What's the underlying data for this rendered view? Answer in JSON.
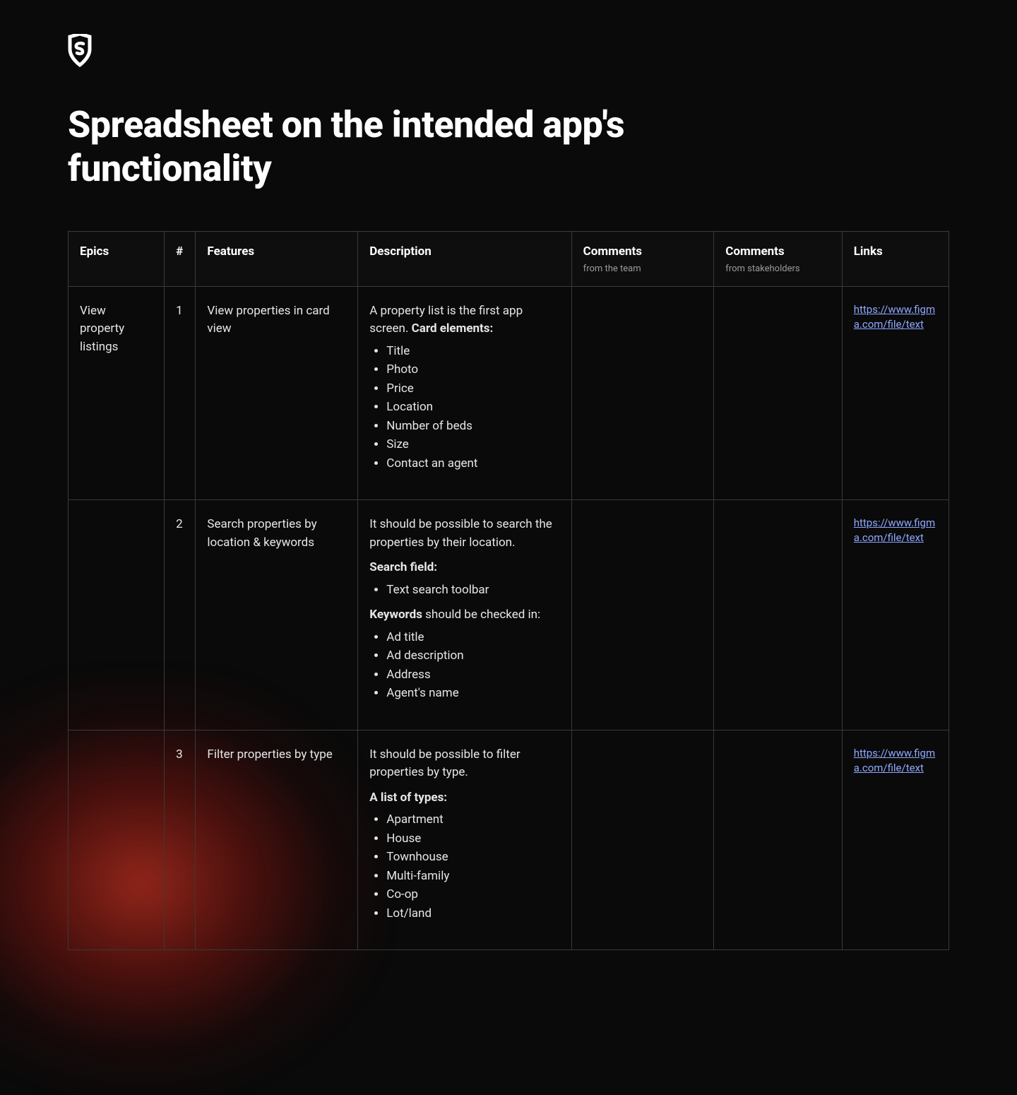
{
  "title": "Spreadsheet on the intended app's functionality",
  "columns": {
    "epics": "Epics",
    "num": "#",
    "features": "Features",
    "description": "Description",
    "comments_team": "Comments",
    "comments_team_sub": "from the team",
    "comments_stake": "Comments",
    "comments_stake_sub": "from stakeholders",
    "links": "Links"
  },
  "rows": [
    {
      "epic": "View property listings",
      "num": "1",
      "feature": "View properties in card view",
      "desc_lead": "A property list is the first app screen.",
      "desc_label": "Card elements:",
      "desc_list": [
        "Title",
        "Photo",
        "Price",
        "Location",
        "Number of beds",
        "Size",
        "Contact an agent"
      ],
      "link": "https://www.figma.com/file/text"
    },
    {
      "epic": "",
      "num": "2",
      "feature": "Search properties by location & keywords",
      "desc_lead": "It should be possible to search the properties by their location.",
      "section1_head": "Search field:",
      "section1_list": [
        "Text search toolbar"
      ],
      "section2_head": "Keywords",
      "section2_tail": " should be checked in:",
      "section2_list": [
        "Ad title",
        "Ad description",
        "Address",
        "Agent's name"
      ],
      "link": "https://www.figma.com/file/text"
    },
    {
      "epic": "",
      "num": "3",
      "feature": "Filter properties by type",
      "desc_lead": "It should be possible to filter properties by type.",
      "desc_label": "A list of types:",
      "desc_list": [
        "Apartment",
        "House",
        "Townhouse",
        "Multi-family",
        "Co-op",
        "Lot/land"
      ],
      "link": "https://www.figma.com/file/text"
    }
  ]
}
